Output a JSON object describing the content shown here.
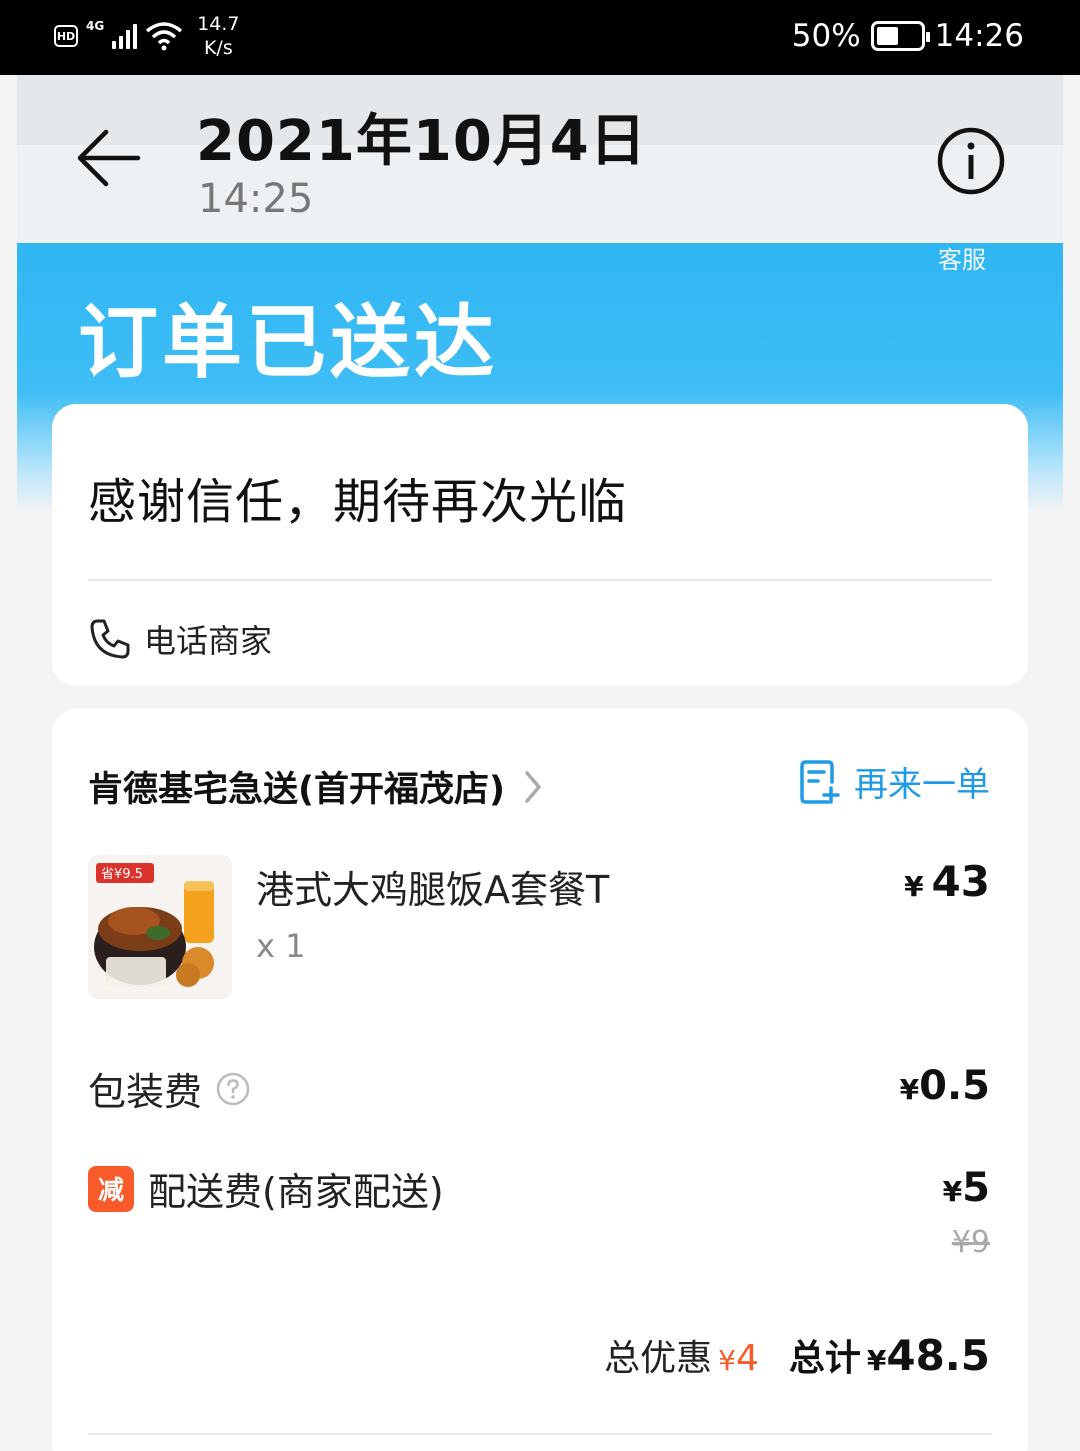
{
  "status_bar": {
    "network": "4G",
    "hd": "HD",
    "speed_value": "14.7",
    "speed_unit": "K/s",
    "battery_percent": "50%",
    "battery_level": 0.5,
    "time": "14:26"
  },
  "header": {
    "date": "2021年10月4日",
    "time": "14:25",
    "service_label": "客服"
  },
  "order": {
    "status_title": "订单已送达",
    "thanks_message": "感谢信任，期待再次光临",
    "call_merchant": "电话商家"
  },
  "store": {
    "name": "肯德基宅急送(首开福茂店)",
    "reorder_label": "再来一单"
  },
  "item": {
    "image_tag": "省¥9.5",
    "name": "港式大鸡腿饭A套餐T",
    "quantity": "x 1",
    "currency": "¥",
    "price": "43"
  },
  "fees": {
    "packaging_label": "包装费",
    "packaging_currency": "¥",
    "packaging_price": "0.5",
    "discount_badge": "减",
    "delivery_label": "配送费(商家配送)",
    "delivery_currency": "¥",
    "delivery_price": "5",
    "delivery_original": "¥9"
  },
  "summary": {
    "discount_label": "总优惠",
    "discount_currency": "¥",
    "discount_value": "4",
    "total_label": "总计",
    "total_currency": "¥",
    "total_value": "48.5"
  },
  "colors": {
    "header_blue": "#2fb6f3",
    "accent_blue": "#1e9be6",
    "discount_orange": "#f85a2a"
  },
  "icons": [
    "back-arrow-icon",
    "info-icon",
    "phone-icon",
    "chevron-right-icon",
    "reorder-icon",
    "help-icon"
  ]
}
